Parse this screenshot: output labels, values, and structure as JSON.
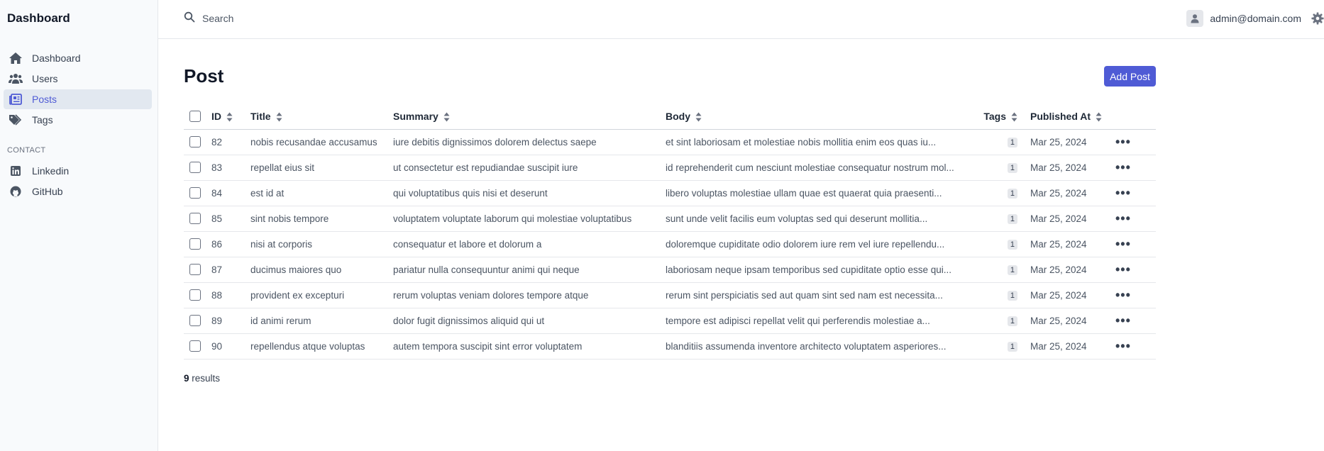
{
  "sidebar": {
    "brand": "Dashboard",
    "items": [
      {
        "label": "Dashboard",
        "icon": "home-icon"
      },
      {
        "label": "Users",
        "icon": "users-icon"
      },
      {
        "label": "Posts",
        "icon": "newspaper-icon",
        "active": true
      },
      {
        "label": "Tags",
        "icon": "tags-icon"
      }
    ],
    "contact_label": "CONTACT",
    "contact_items": [
      {
        "label": "Linkedin",
        "icon": "linkedin-icon"
      },
      {
        "label": "GitHub",
        "icon": "github-icon"
      }
    ]
  },
  "topbar": {
    "search_placeholder": "Search",
    "user_email": "admin@domain.com"
  },
  "main": {
    "title": "Post",
    "add_button": "Add Post",
    "columns": [
      "ID",
      "Title",
      "Summary",
      "Body",
      "Tags",
      "Published At"
    ],
    "rows": [
      {
        "id": "82",
        "title": "nobis recusandae accusamus",
        "summary": "iure debitis dignissimos dolorem delectus saepe",
        "body": "et sint laboriosam et molestiae nobis mollitia enim eos quas iu...",
        "tags": "1",
        "published": "Mar 25, 2024"
      },
      {
        "id": "83",
        "title": "repellat eius sit",
        "summary": "ut consectetur est repudiandae suscipit iure",
        "body": "id reprehenderit cum nesciunt molestiae consequatur nostrum mol...",
        "tags": "1",
        "published": "Mar 25, 2024"
      },
      {
        "id": "84",
        "title": "est id at",
        "summary": "qui voluptatibus quis nisi et deserunt",
        "body": "libero voluptas molestiae ullam quae est quaerat quia praesenti...",
        "tags": "1",
        "published": "Mar 25, 2024"
      },
      {
        "id": "85",
        "title": "sint nobis tempore",
        "summary": "voluptatem voluptate laborum qui molestiae voluptatibus",
        "body": "sunt unde velit facilis eum voluptas sed qui deserunt mollitia...",
        "tags": "1",
        "published": "Mar 25, 2024"
      },
      {
        "id": "86",
        "title": "nisi at corporis",
        "summary": "consequatur et labore et dolorum a",
        "body": "doloremque cupiditate odio dolorem iure rem vel iure repellendu...",
        "tags": "1",
        "published": "Mar 25, 2024"
      },
      {
        "id": "87",
        "title": "ducimus maiores quo",
        "summary": "pariatur nulla consequuntur animi qui neque",
        "body": "laboriosam neque ipsam temporibus sed cupiditate optio esse qui...",
        "tags": "1",
        "published": "Mar 25, 2024"
      },
      {
        "id": "88",
        "title": "provident ex excepturi",
        "summary": "rerum voluptas veniam dolores tempore atque",
        "body": "rerum sint perspiciatis sed aut quam sint sed nam est necessita...",
        "tags": "1",
        "published": "Mar 25, 2024"
      },
      {
        "id": "89",
        "title": "id animi rerum",
        "summary": "dolor fugit dignissimos aliquid qui ut",
        "body": "tempore est adipisci repellat velit qui perferendis molestiae a...",
        "tags": "1",
        "published": "Mar 25, 2024"
      },
      {
        "id": "90",
        "title": "repellendus atque voluptas",
        "summary": "autem tempora suscipit sint error voluptatem",
        "body": "blanditiis assumenda inventore architecto voluptatem asperiores...",
        "tags": "1",
        "published": "Mar 25, 2024"
      }
    ],
    "results_count": "9",
    "results_label": "results"
  },
  "colors": {
    "accent": "#4f5bd5",
    "sidebar_bg": "#f8fafc",
    "active_bg": "#e2e8f0"
  }
}
